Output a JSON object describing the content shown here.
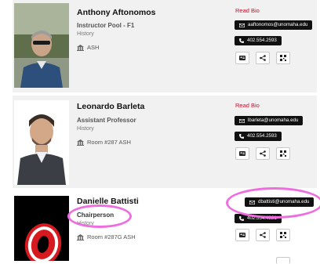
{
  "people": [
    {
      "name": "Anthony Aftonomos",
      "title": "Instructor Pool - F1",
      "dept": "History",
      "room": "ASH",
      "read_bio": "Read Bio",
      "email": "aaftonomos@unomaha.edu",
      "phone": "402.554.2593"
    },
    {
      "name": "Leonardo Barleta",
      "title": "Assistant Professor",
      "dept": "History",
      "room": "Room #287 ASH",
      "read_bio": "Read Bio",
      "email": "lbarleta@unomaha.edu",
      "phone": "402.554.2593"
    },
    {
      "name": "Danielle Battisti",
      "title": "Chairperson",
      "dept": "History",
      "room": "Room #287G ASH",
      "email": "dbattisti@unomaha.edu",
      "phone": "402.554.4821"
    }
  ],
  "colors": {
    "accent_red": "#c8102e",
    "highlight": "#ee6ee0",
    "button": "#111111",
    "card_gray": "#f1f1f1"
  },
  "icons": {
    "email": "envelope-icon",
    "phone": "phone-icon",
    "room": "building-icon",
    "vcard": "vcard-icon",
    "share": "share-icon",
    "qr": "qr-code-icon"
  }
}
